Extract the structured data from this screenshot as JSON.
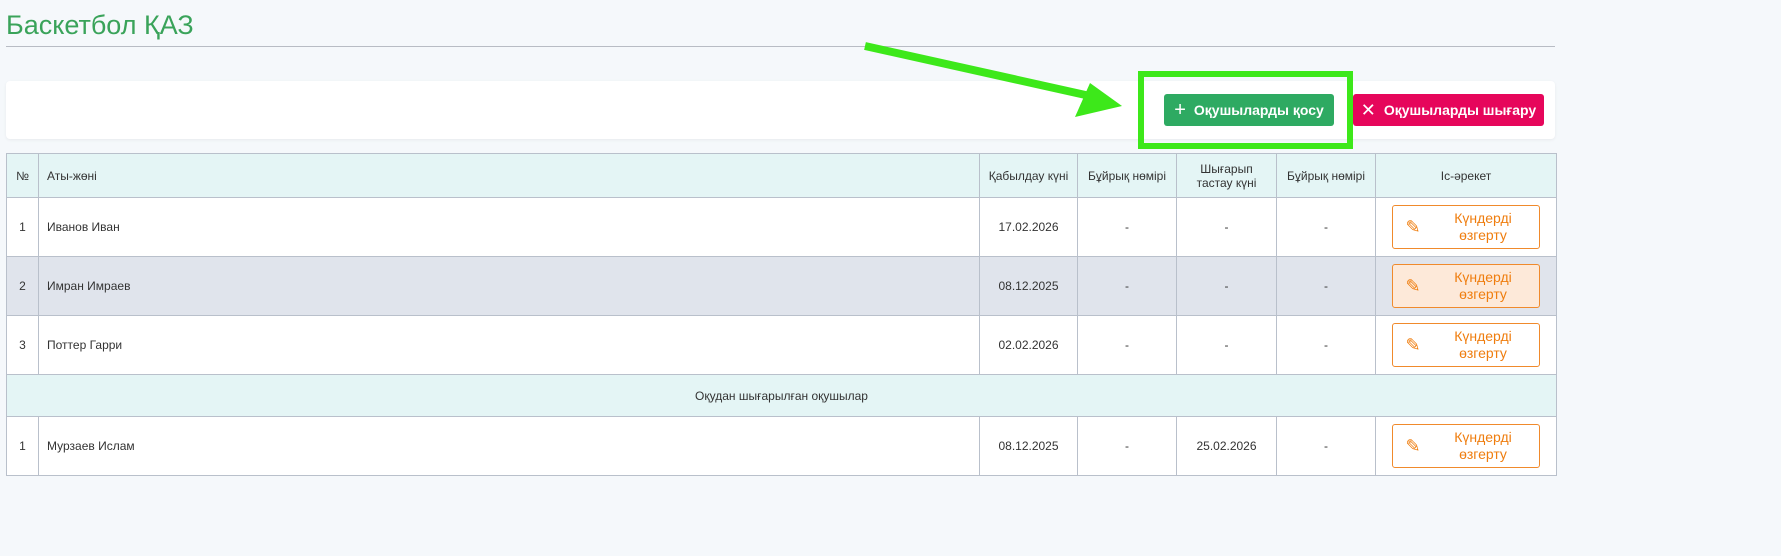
{
  "page": {
    "title": "Баскетбол ҚАЗ"
  },
  "toolbar": {
    "add_label": "Оқушыларды қосу",
    "remove_label": "Оқушыларды шығару"
  },
  "table": {
    "headers": [
      "№",
      "Аты-жөні",
      "Қабылдау күні",
      "Бұйрық нөмірі",
      "Шығарып тастау күні",
      "Бұйрық нөмірі",
      "Іс-әрекет"
    ],
    "rows": [
      {
        "n": "1",
        "name": "Иванов Иван",
        "admit": "17.02.2026",
        "order1": "-",
        "expel": "-",
        "order2": "-",
        "action": "Күндерді өзгерту"
      },
      {
        "n": "2",
        "name": "Имран Имраев",
        "admit": "08.12.2025",
        "order1": "-",
        "expel": "-",
        "order2": "-",
        "action": "Күндерді өзгерту"
      },
      {
        "n": "3",
        "name": "Поттер Гарри",
        "admit": "02.02.2026",
        "order1": "-",
        "expel": "-",
        "order2": "-",
        "action": "Күндерді өзгерту"
      }
    ],
    "section_label": "Оқудан шығарылған оқушылар",
    "expelled": [
      {
        "n": "1",
        "name": "Мурзаев Ислам",
        "admit": "08.12.2025",
        "order1": "-",
        "expel": "25.02.2026",
        "order2": "-",
        "action": "Күндерді өзгерту"
      }
    ]
  },
  "colors": {
    "accent": "#3aa35a",
    "add": "#2eaa62",
    "remove": "#e6065b",
    "edit": "#ef7d0e",
    "highlight": "#3de81a"
  }
}
